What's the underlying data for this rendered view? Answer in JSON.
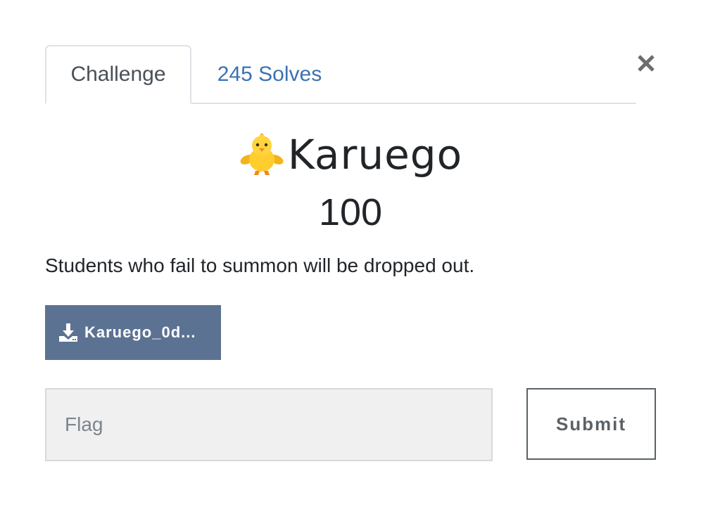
{
  "tabs": {
    "challenge_label": "Challenge",
    "solves_label": "245 Solves"
  },
  "close_icon": "close-icon",
  "challenge": {
    "icon": "baby-chick-icon",
    "name": "Karuego",
    "points": "100",
    "description": "Students who fail to summon will be dropped out."
  },
  "files": [
    {
      "icon": "download-icon",
      "label": "Karuego_0d..."
    }
  ],
  "flag": {
    "value": "",
    "placeholder": "Flag"
  },
  "submit_label": "Submit",
  "colors": {
    "link_blue": "#3b72b3",
    "file_button_bg": "#5c7292",
    "input_bg": "#f0f0f0",
    "text_dark": "#212529",
    "submit_border": "#5a6268"
  }
}
